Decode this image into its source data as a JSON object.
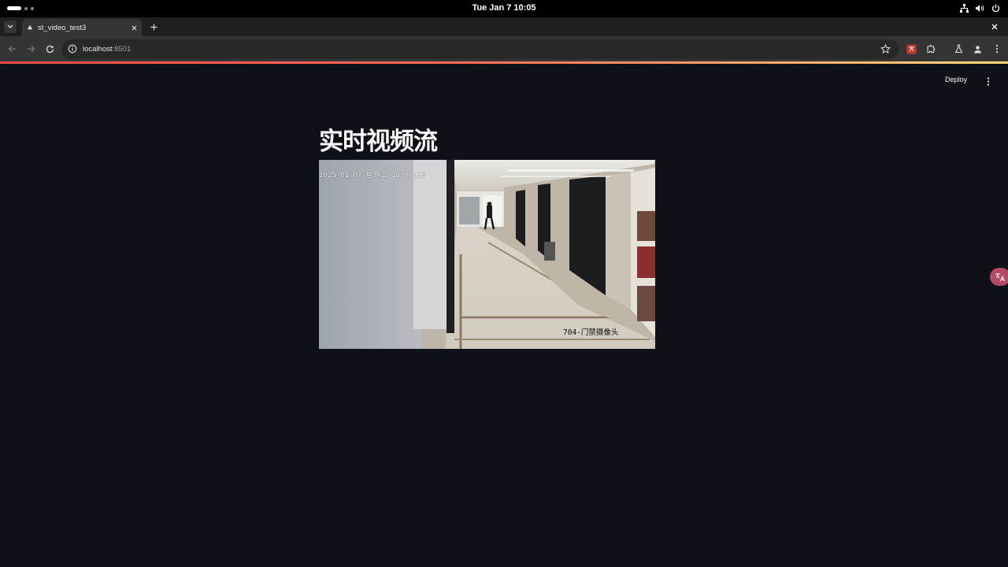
{
  "os": {
    "clock": "Tue Jan 7  10:05"
  },
  "browser": {
    "tab_title": "st_video_test3",
    "url_host": "localhost",
    "url_port": ":8501"
  },
  "app": {
    "deploy_label": "Deploy",
    "title": "实时视频流",
    "video": {
      "osd_timestamp": "2025-01-07 星期二 10:06:22",
      "osd_camera": "704-门禁摄像头"
    }
  }
}
